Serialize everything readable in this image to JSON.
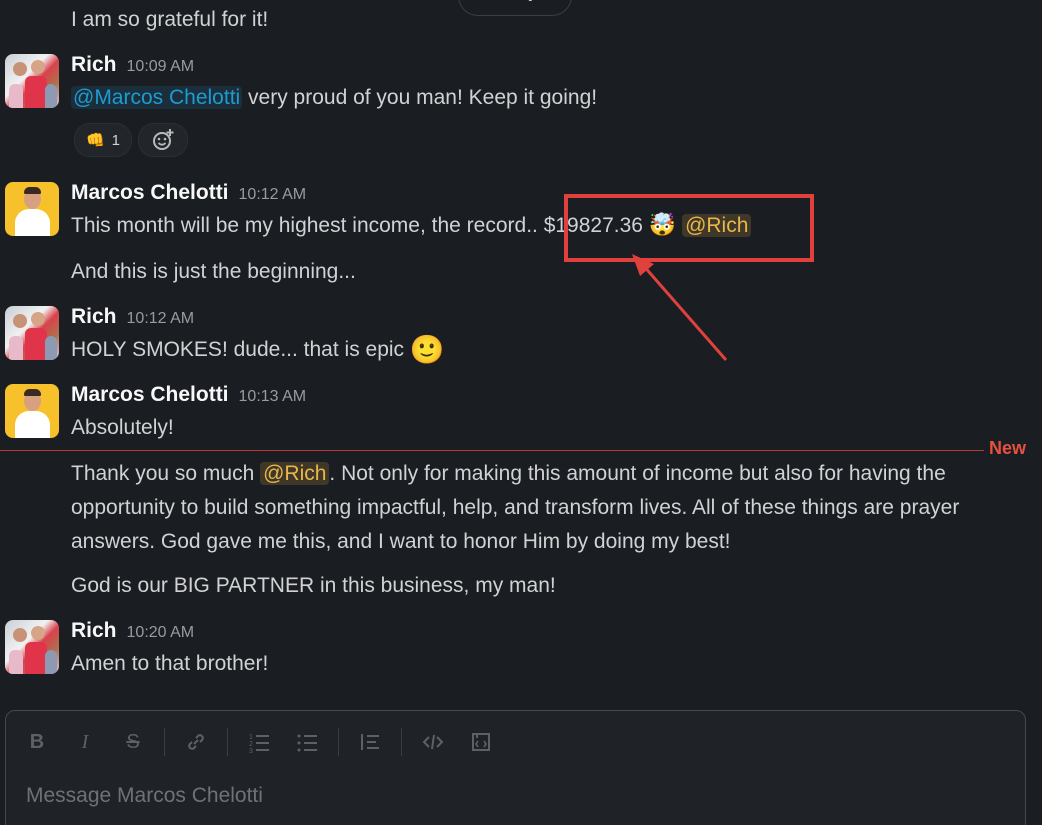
{
  "day_divider": {
    "label": "Today"
  },
  "messages": [
    {
      "text": "I am so grateful for it!"
    },
    {
      "author": "Rich",
      "time": "10:09 AM",
      "mention": "@Marcos Chelotti",
      "text": " very proud of you man! Keep it going!",
      "reactions": [
        {
          "emoji": "👊",
          "count": "1"
        }
      ]
    },
    {
      "author": "Marcos Chelotti",
      "time": "10:12 AM",
      "text_before": "This month will be my highest income, the record.. ",
      "amount": "$19827.36",
      "emoji": "🤯",
      "mention": "@Rich",
      "text2": "And this is just the beginning..."
    },
    {
      "author": "Rich",
      "time": "10:12 AM",
      "text": "HOLY SMOKES! dude... that is epic",
      "emoji": "🙂"
    },
    {
      "author": "Marcos Chelotti",
      "time": "10:13 AM",
      "text": "Absolutely!",
      "new_text_before": "Thank you so much ",
      "new_mention": "@Rich",
      "new_text_after": ". Not only for making this amount of income but also for having the opportunity to build something impactful, help, and transform lives. All of these things are prayer answers. God gave me this, and I want to honor Him by doing my best!",
      "text3": "God is our BIG PARTNER in this business, my man!"
    },
    {
      "author": "Rich",
      "time": "10:20 AM",
      "text": "Amen to that brother!"
    }
  ],
  "new_divider": {
    "label": "New"
  },
  "composer": {
    "placeholder": "Message Marcos Chelotti",
    "tools": [
      "bold-icon",
      "italic-icon",
      "strikethrough-icon",
      "link-icon",
      "ordered-list-icon",
      "bulleted-list-icon",
      "blockquote-icon",
      "code-icon",
      "code-block-icon"
    ]
  },
  "colors": {
    "background": "#1a1d21",
    "mention": "#1d9bd1",
    "mention_self": "#e8b64a",
    "highlight": "#e0413c",
    "new_line": "#b33a36"
  }
}
